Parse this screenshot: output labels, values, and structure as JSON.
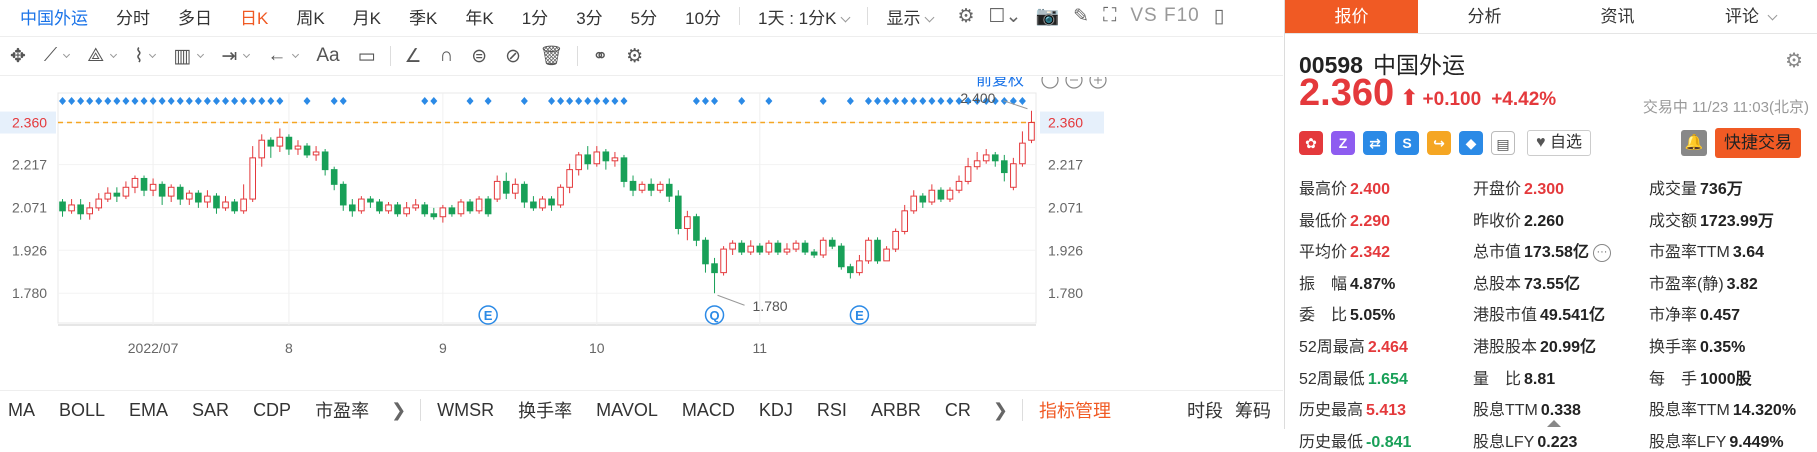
{
  "topbar": {
    "stock_name": "中国外运",
    "periods": [
      "分时",
      "多日",
      "日K",
      "周K",
      "月K",
      "季K",
      "年K",
      "1分",
      "3分",
      "5分",
      "10分"
    ],
    "active_period": "日K",
    "interval_select": "1天 : 1分K",
    "display_label": "显示",
    "vs_label": "VS F10"
  },
  "chart": {
    "adjust_label": "前复权",
    "price_label": "2.360",
    "y_ticks": [
      "2.360",
      "2.217",
      "2.071",
      "1.926",
      "1.780"
    ],
    "x_ticks": [
      "2022/07",
      "8",
      "9",
      "10",
      "11"
    ],
    "high_annotation": "2.400",
    "low_annotation": "1.780",
    "event_markers": [
      "E",
      "Q",
      "E"
    ]
  },
  "chart_data": {
    "type": "candlestick",
    "title": "",
    "ylim": [
      1.74,
      2.44
    ],
    "reference_price": 2.36,
    "colors": {
      "up": "#e4393c",
      "down": "#18a058",
      "reference": "#f5a623",
      "marker": "#2b8ae6"
    },
    "candles": [
      [
        2.09,
        2.06,
        2.1,
        2.04
      ],
      [
        2.06,
        2.08,
        2.1,
        2.05
      ],
      [
        2.08,
        2.05,
        2.1,
        2.03
      ],
      [
        2.05,
        2.07,
        2.09,
        2.03
      ],
      [
        2.07,
        2.1,
        2.12,
        2.06
      ],
      [
        2.1,
        2.12,
        2.14,
        2.09
      ],
      [
        2.12,
        2.11,
        2.14,
        2.09
      ],
      [
        2.11,
        2.14,
        2.16,
        2.1
      ],
      [
        2.14,
        2.17,
        2.18,
        2.12
      ],
      [
        2.17,
        2.13,
        2.18,
        2.11
      ],
      [
        2.13,
        2.15,
        2.17,
        2.11
      ],
      [
        2.15,
        2.11,
        2.16,
        2.08
      ],
      [
        2.11,
        2.14,
        2.15,
        2.09
      ],
      [
        2.14,
        2.1,
        2.15,
        2.08
      ],
      [
        2.1,
        2.12,
        2.13,
        2.08
      ],
      [
        2.12,
        2.09,
        2.13,
        2.07
      ],
      [
        2.09,
        2.11,
        2.13,
        2.07
      ],
      [
        2.11,
        2.07,
        2.12,
        2.05
      ],
      [
        2.07,
        2.09,
        2.11,
        2.06
      ],
      [
        2.09,
        2.06,
        2.1,
        2.05
      ],
      [
        2.06,
        2.1,
        2.15,
        2.05
      ],
      [
        2.1,
        2.24,
        2.28,
        2.09
      ],
      [
        2.24,
        2.3,
        2.32,
        2.21
      ],
      [
        2.3,
        2.28,
        2.31,
        2.24
      ],
      [
        2.28,
        2.31,
        2.34,
        2.26
      ],
      [
        2.31,
        2.27,
        2.32,
        2.25
      ],
      [
        2.27,
        2.28,
        2.3,
        2.25
      ],
      [
        2.28,
        2.25,
        2.29,
        2.24
      ],
      [
        2.25,
        2.26,
        2.28,
        2.23
      ],
      [
        2.26,
        2.2,
        2.27,
        2.18
      ],
      [
        2.2,
        2.15,
        2.21,
        2.13
      ],
      [
        2.15,
        2.08,
        2.16,
        2.06
      ],
      [
        2.08,
        2.06,
        2.1,
        2.04
      ],
      [
        2.06,
        2.1,
        2.11,
        2.05
      ],
      [
        2.1,
        2.09,
        2.11,
        2.07
      ],
      [
        2.09,
        2.06,
        2.1,
        2.05
      ],
      [
        2.06,
        2.08,
        2.09,
        2.05
      ],
      [
        2.08,
        2.05,
        2.09,
        2.04
      ],
      [
        2.05,
        2.07,
        2.09,
        2.04
      ],
      [
        2.07,
        2.08,
        2.1,
        2.06
      ],
      [
        2.08,
        2.05,
        2.09,
        2.04
      ],
      [
        2.05,
        2.04,
        2.07,
        2.03
      ],
      [
        2.04,
        2.07,
        2.08,
        2.02
      ],
      [
        2.07,
        2.05,
        2.08,
        2.04
      ],
      [
        2.05,
        2.09,
        2.1,
        2.04
      ],
      [
        2.09,
        2.06,
        2.1,
        2.05
      ],
      [
        2.06,
        2.1,
        2.11,
        2.05
      ],
      [
        2.1,
        2.05,
        2.11,
        2.04
      ],
      [
        2.1,
        2.16,
        2.18,
        2.09
      ],
      [
        2.16,
        2.12,
        2.19,
        2.1
      ],
      [
        2.12,
        2.15,
        2.17,
        2.1
      ],
      [
        2.15,
        2.09,
        2.16,
        2.07
      ],
      [
        2.09,
        2.07,
        2.11,
        2.06
      ],
      [
        2.07,
        2.1,
        2.11,
        2.06
      ],
      [
        2.1,
        2.08,
        2.11,
        2.06
      ],
      [
        2.08,
        2.14,
        2.15,
        2.07
      ],
      [
        2.14,
        2.2,
        2.22,
        2.12
      ],
      [
        2.2,
        2.25,
        2.26,
        2.18
      ],
      [
        2.25,
        2.22,
        2.28,
        2.2
      ],
      [
        2.22,
        2.26,
        2.28,
        2.21
      ],
      [
        2.26,
        2.23,
        2.27,
        2.2
      ],
      [
        2.23,
        2.24,
        2.26,
        2.21
      ],
      [
        2.24,
        2.16,
        2.25,
        2.14
      ],
      [
        2.16,
        2.13,
        2.18,
        2.11
      ],
      [
        2.13,
        2.15,
        2.16,
        2.12
      ],
      [
        2.15,
        2.13,
        2.17,
        2.11
      ],
      [
        2.13,
        2.15,
        2.16,
        2.12
      ],
      [
        2.15,
        2.11,
        2.17,
        2.09
      ],
      [
        2.11,
        2.0,
        2.13,
        1.98
      ],
      [
        2.0,
        2.04,
        2.06,
        1.96
      ],
      [
        2.04,
        1.96,
        2.05,
        1.94
      ],
      [
        1.96,
        1.88,
        1.97,
        1.85
      ],
      [
        1.88,
        1.85,
        1.9,
        1.78
      ],
      [
        1.85,
        1.93,
        1.94,
        1.84
      ],
      [
        1.93,
        1.95,
        1.96,
        1.91
      ],
      [
        1.95,
        1.92,
        1.96,
        1.91
      ],
      [
        1.92,
        1.94,
        1.96,
        1.91
      ],
      [
        1.94,
        1.92,
        1.95,
        1.91
      ],
      [
        1.92,
        1.95,
        1.96,
        1.91
      ],
      [
        1.95,
        1.92,
        1.96,
        1.91
      ],
      [
        1.92,
        1.93,
        1.95,
        1.91
      ],
      [
        1.93,
        1.95,
        1.96,
        1.92
      ],
      [
        1.95,
        1.92,
        1.96,
        1.91
      ],
      [
        1.92,
        1.91,
        1.93,
        1.9
      ],
      [
        1.91,
        1.96,
        1.97,
        1.9
      ],
      [
        1.96,
        1.94,
        1.97,
        1.93
      ],
      [
        1.94,
        1.87,
        1.95,
        1.86
      ],
      [
        1.87,
        1.85,
        1.88,
        1.83
      ],
      [
        1.85,
        1.89,
        1.91,
        1.84
      ],
      [
        1.89,
        1.96,
        1.97,
        1.88
      ],
      [
        1.96,
        1.89,
        1.97,
        1.88
      ],
      [
        1.89,
        1.93,
        1.94,
        1.89
      ],
      [
        1.93,
        1.99,
        2.0,
        1.92
      ],
      [
        1.99,
        2.06,
        2.08,
        1.98
      ],
      [
        2.06,
        2.11,
        2.13,
        2.05
      ],
      [
        2.11,
        2.09,
        2.12,
        2.07
      ],
      [
        2.09,
        2.13,
        2.15,
        2.08
      ],
      [
        2.13,
        2.1,
        2.14,
        2.09
      ],
      [
        2.1,
        2.13,
        2.14,
        2.09
      ],
      [
        2.13,
        2.16,
        2.18,
        2.12
      ],
      [
        2.16,
        2.21,
        2.24,
        2.15
      ],
      [
        2.21,
        2.23,
        2.26,
        2.2
      ],
      [
        2.23,
        2.25,
        2.27,
        2.22
      ],
      [
        2.25,
        2.23,
        2.26,
        2.21
      ],
      [
        2.23,
        2.19,
        2.25,
        2.16
      ],
      [
        2.14,
        2.22,
        2.24,
        2.13
      ],
      [
        2.22,
        2.29,
        2.33,
        2.21
      ],
      [
        2.3,
        2.36,
        2.4,
        2.29
      ]
    ],
    "dot_groups": [
      [
        0,
        24
      ],
      [
        27,
        27
      ],
      [
        30,
        31
      ],
      [
        40,
        41
      ],
      [
        45,
        45
      ],
      [
        47,
        47
      ],
      [
        51,
        51
      ],
      [
        54,
        62
      ],
      [
        70,
        72
      ],
      [
        75,
        75
      ],
      [
        78,
        78
      ],
      [
        84,
        84
      ],
      [
        87,
        87
      ],
      [
        89,
        106
      ]
    ]
  },
  "toolbar": {
    "font_label": "Aa"
  },
  "indicators": {
    "tabs": [
      "MA",
      "BOLL",
      "EMA",
      "SAR",
      "CDP",
      "市盈率"
    ],
    "tabs2": [
      "WMSR",
      "换手率",
      "MAVOL",
      "MACD",
      "KDJ",
      "RSI",
      "ARBR",
      "CR"
    ],
    "manage": "指标管理",
    "right_tabs": [
      "时段",
      "筹码"
    ]
  },
  "panel": {
    "tabs": [
      "报价",
      "分析",
      "资讯",
      "评论"
    ],
    "code": "00598",
    "name": "中国外运",
    "price": "2.360",
    "change": "+0.100",
    "change_pct": "+4.42%",
    "status": "交易中 11/23 11:03(北京)",
    "watch_label": "自选",
    "quick_trade": "快捷交易",
    "badges": [
      "HK",
      "Z",
      "X",
      "S",
      "↪",
      "◆",
      "▤"
    ],
    "stats": [
      {
        "label": "最高价",
        "value": "2.400",
        "color": "red"
      },
      {
        "label": "开盘价",
        "value": "2.300",
        "color": "red"
      },
      {
        "label": "成交量",
        "value": "736万",
        "color": "dark"
      },
      {
        "label": "最低价",
        "value": "2.290",
        "color": "red"
      },
      {
        "label": "昨收价",
        "value": "2.260",
        "color": "dark"
      },
      {
        "label": "成交额",
        "value": "1723.99万",
        "color": "dark"
      },
      {
        "label": "平均价",
        "value": "2.342",
        "color": "red"
      },
      {
        "label": "总市值",
        "value": "173.58亿",
        "color": "dark"
      },
      {
        "label": "市盈率TTM",
        "value": "3.64",
        "color": "dark"
      },
      {
        "label": "振　幅",
        "value": "4.87%",
        "color": "dark"
      },
      {
        "label": "总股本",
        "value": "73.55亿",
        "color": "dark"
      },
      {
        "label": "市盈率(静)",
        "value": "3.82",
        "color": "dark"
      },
      {
        "label": "委　比",
        "value": "5.05%",
        "color": "dark"
      },
      {
        "label": "港股市值",
        "value": "49.541亿",
        "color": "dark"
      },
      {
        "label": "市净率",
        "value": "0.457",
        "color": "dark"
      },
      {
        "label": "52周最高",
        "value": "2.464",
        "color": "red"
      },
      {
        "label": "港股股本",
        "value": "20.99亿",
        "color": "dark"
      },
      {
        "label": "换手率",
        "value": "0.35%",
        "color": "dark"
      },
      {
        "label": "52周最低",
        "value": "1.654",
        "color": "green"
      },
      {
        "label": "量　比",
        "value": "8.81",
        "color": "dark"
      },
      {
        "label": "每　手",
        "value": "1000股",
        "color": "dark"
      },
      {
        "label": "历史最高",
        "value": "5.413",
        "color": "red"
      },
      {
        "label": "股息TTM",
        "value": "0.338",
        "color": "dark"
      },
      {
        "label": "股息率TTM",
        "value": "14.320%",
        "color": "dark"
      },
      {
        "label": "历史最低",
        "value": "-0.841",
        "color": "green"
      },
      {
        "label": "股息LFY",
        "value": "0.223",
        "color": "dark"
      },
      {
        "label": "股息率LFY",
        "value": "9.449%",
        "color": "dark"
      }
    ]
  }
}
